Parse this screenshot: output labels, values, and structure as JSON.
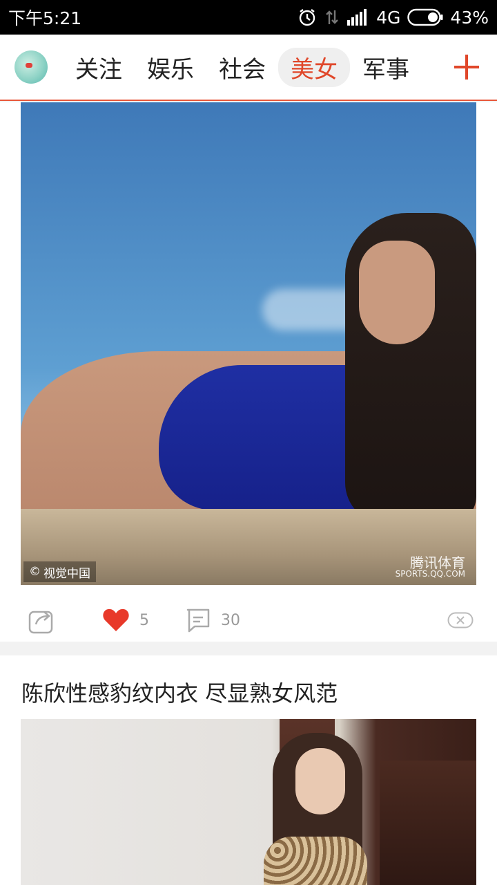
{
  "status_bar": {
    "time": "下午5:21",
    "network": "4G",
    "battery": "43%"
  },
  "nav": {
    "tabs": [
      {
        "label": "关注",
        "active": false
      },
      {
        "label": "娱乐",
        "active": false
      },
      {
        "label": "社会",
        "active": false
      },
      {
        "label": "美女",
        "active": true
      },
      {
        "label": "军事",
        "active": false
      }
    ]
  },
  "feed": {
    "card1": {
      "watermark_left": "视觉中国",
      "watermark_right": "腾讯体育",
      "watermark_right_sub": "SPORTS.QQ.COM",
      "likes": "5",
      "comments": "30"
    },
    "card2": {
      "title": "陈欣性感豹纹内衣 尽显熟女风范"
    }
  },
  "colors": {
    "accent": "#e0472a",
    "like": "#e8392a"
  }
}
